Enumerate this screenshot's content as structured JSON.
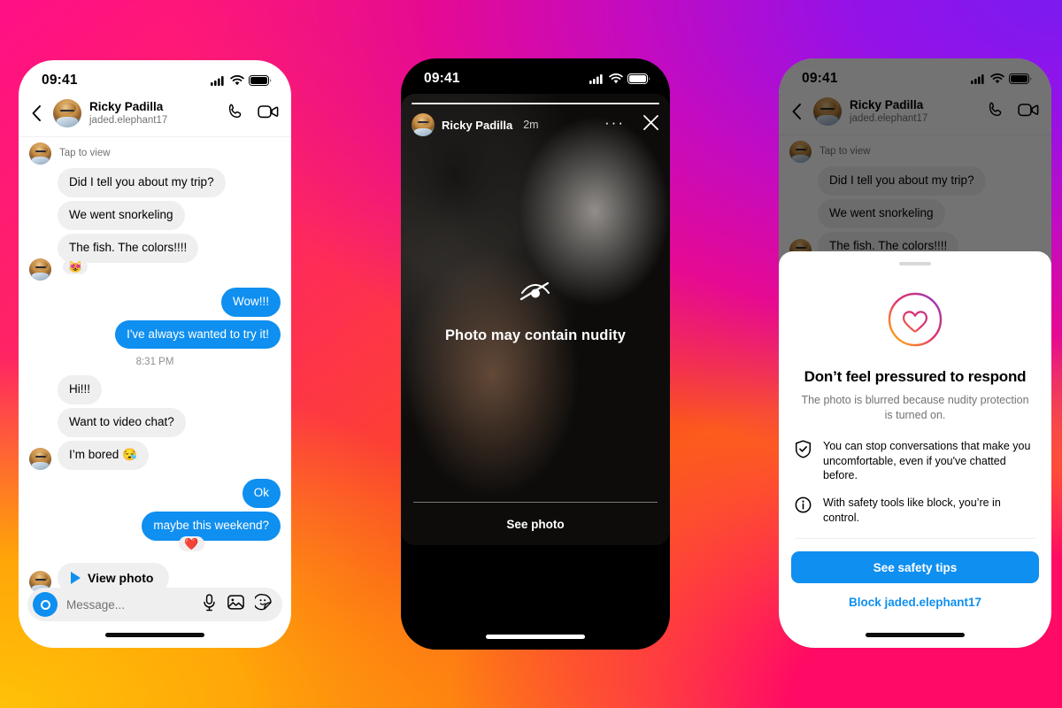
{
  "background": {
    "gradient_colors": [
      "#ff0080",
      "#7b1bf0",
      "#ff0a64",
      "#fb4a22",
      "#ffc107"
    ]
  },
  "accent": {
    "blue": "#0f8ff0",
    "bubble_gray": "#efefef",
    "muted_text": "#737373"
  },
  "phone1": {
    "status": {
      "time": "09:41",
      "cellular_icon": "signal-bars-icon",
      "wifi_icon": "wifi-icon",
      "battery_icon": "battery-icon"
    },
    "header": {
      "back_icon": "back-chevron-icon",
      "name": "Ricky Padilla",
      "username": "jaded.elephant17",
      "call_icon": "phone-call-icon",
      "video_icon": "video-camera-icon"
    },
    "thread": {
      "photo_caption": "Tap to view",
      "timestamp": "8:31 PM",
      "messages": [
        {
          "id": "m1",
          "side": "them",
          "type": "photo",
          "text": ""
        },
        {
          "id": "m2",
          "side": "them",
          "type": "text",
          "text": "Did I tell you about my trip?"
        },
        {
          "id": "m3",
          "side": "them",
          "type": "text",
          "text": "We went snorkeling"
        },
        {
          "id": "m4",
          "side": "them",
          "type": "text",
          "text": "The fish. The colors!!!!",
          "reaction": "😻"
        },
        {
          "id": "m5",
          "side": "me",
          "type": "text",
          "text": "Wow!!!"
        },
        {
          "id": "m6",
          "side": "me",
          "type": "text",
          "text": "I've always wanted to try it!"
        },
        {
          "id": "m7",
          "side": "them",
          "type": "text",
          "text": "Hi!!!"
        },
        {
          "id": "m8",
          "side": "them",
          "type": "text",
          "text": "Want to video chat?"
        },
        {
          "id": "m9",
          "side": "them",
          "type": "text",
          "text": "I’m bored 😪"
        },
        {
          "id": "m10",
          "side": "me",
          "type": "text",
          "text": "Ok"
        },
        {
          "id": "m11",
          "side": "me",
          "type": "text",
          "text": "maybe this weekend?",
          "reaction": "❤️"
        },
        {
          "id": "m12",
          "side": "them",
          "type": "action",
          "text": "View photo"
        }
      ]
    },
    "composer": {
      "camera_icon": "camera-icon",
      "placeholder": "Message...",
      "mic_icon": "microphone-icon",
      "gallery_icon": "image-icon",
      "sticker_icon": "sticker-icon"
    }
  },
  "phone2": {
    "status": {
      "time": "09:41",
      "cellular_icon": "signal-bars-icon",
      "wifi_icon": "wifi-icon",
      "battery_icon": "battery-icon"
    },
    "story": {
      "name": "Ricky Padilla",
      "time_ago": "2m",
      "more_icon": "more-options-icon",
      "close_icon": "close-x-icon",
      "warning_icon": "eye-slash-icon",
      "warning_title": "Photo may contain nudity",
      "see_photo_label": "See photo"
    }
  },
  "phone3": {
    "status": {
      "time": "09:41",
      "cellular_icon": "signal-bars-icon",
      "wifi_icon": "wifi-icon",
      "battery_icon": "battery-icon"
    },
    "header": {
      "back_icon": "back-chevron-icon",
      "name": "Ricky Padilla",
      "username": "jaded.elephant17",
      "call_icon": "phone-call-icon",
      "video_icon": "video-camera-icon"
    },
    "thread": {
      "photo_caption": "Tap to view",
      "messages": [
        {
          "id": "b1",
          "side": "them",
          "type": "photo",
          "text": ""
        },
        {
          "id": "b2",
          "side": "them",
          "type": "text",
          "text": "Did I tell you about my trip?"
        },
        {
          "id": "b3",
          "side": "them",
          "type": "text",
          "text": "We went snorkeling"
        },
        {
          "id": "b4",
          "side": "them",
          "type": "text",
          "text": "The fish. The colors!!!!"
        }
      ]
    },
    "sheet": {
      "grabber": "drag-handle",
      "heart_icon": "gradient-heart-icon",
      "title": "Don’t feel pressured to respond",
      "subtitle": "The photo is blurred because nudity protection is turned on.",
      "bullets": [
        {
          "icon": "shield-check-icon",
          "text": "You can stop conversations that make you uncomfortable, even if you've chatted before."
        },
        {
          "icon": "info-circle-icon",
          "text": "With safety tools like block, you’re in control."
        }
      ],
      "primary_button": "See safety tips",
      "secondary_link": "Block jaded.elephant17"
    }
  }
}
